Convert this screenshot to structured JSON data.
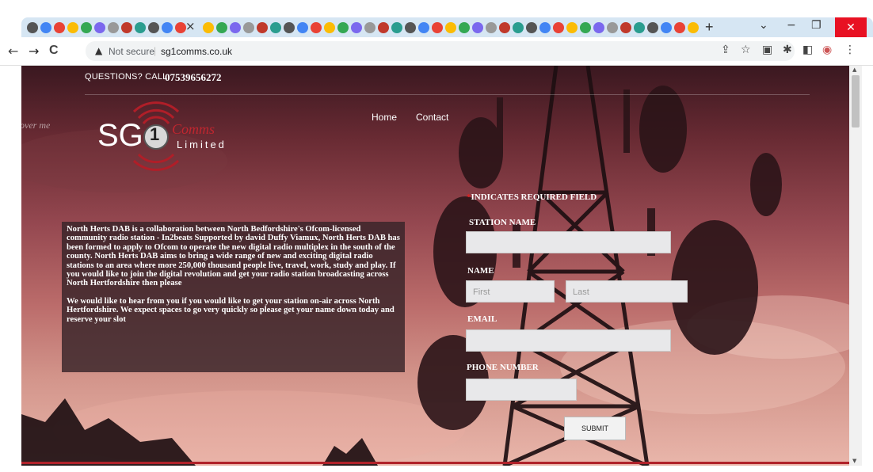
{
  "browser": {
    "tab_close_glyph": "×",
    "new_tab_glyph": "+",
    "minimize_glyph": "−",
    "restore_glyph": "❐",
    "close_glyph": "✕",
    "dropdown_glyph": "⌄",
    "not_secure_label": "Not secure",
    "url": "sg1comms.co.uk",
    "back_glyph": "←",
    "forward_glyph": "→",
    "reload_glyph": "C"
  },
  "page": {
    "questions_label": "QUESTIONS? CALL:",
    "phone_number": "07539656272",
    "nav": {
      "home": "Home",
      "contact": "Contact"
    },
    "logo": {
      "sg": "SG",
      "one": "1",
      "comms": "Comms",
      "limited": "Limited"
    },
    "cover_me": "over me",
    "intro_paragraph": "North Herts DAB is a collaboration between North Bedfordshire's Ofcom-licensed community radio station - In2beats Supported by david Duffy Viamux, North Herts DAB has been formed to apply to Ofcom to operate the new digital radio multiplex in the south of the county.  North Herts DAB aims to bring a wide range of new and exciting digital radio stations to an area where more 250,000 thousand people live, travel, work, study and play. If you would like to join the digital revolution and get your radio station broadcasting across North Hertfordshire then please",
    "cta_paragraph": "We would like to hear from you if you would like to get your station on-air across North Hertfordshire. We expect spaces to go very quickly so please get your name down today and reserve your slot"
  },
  "form": {
    "required_marker": "*",
    "required_note": "INDICATES REQUIRED FIELD",
    "station_name_label": "STATION NAME",
    "name_label": "NAME",
    "first_placeholder": "First",
    "last_placeholder": "Last",
    "email_label": "EMAIL",
    "phone_label": "PHONE NUMBER",
    "submit_label": "SUBMIT"
  },
  "colors": {
    "accent_red": "#b0222a",
    "close_red": "#e81123",
    "tabstrip_blue": "#d6e6f3"
  }
}
